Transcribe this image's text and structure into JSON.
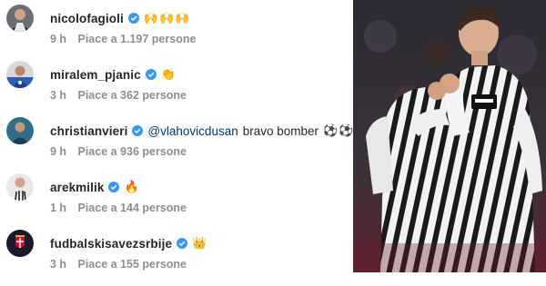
{
  "comments": [
    {
      "username": "nicolofagioli",
      "verified": true,
      "mention": "",
      "text": "",
      "emoji": "🙌🙌🙌",
      "time": "9 h",
      "likes": "Piace a 1.197 persone",
      "avatar": "avatar-fagioli"
    },
    {
      "username": "miralem_pjanic",
      "verified": true,
      "mention": "",
      "text": "",
      "emoji": "👏",
      "time": "3 h",
      "likes": "Piace a 362 persone",
      "avatar": "avatar-pjanic"
    },
    {
      "username": "christianvieri",
      "verified": true,
      "mention": "@vlahovicdusan",
      "text": "bravo bomber",
      "emoji": "⚽⚽",
      "time": "9 h",
      "likes": "Piace a 936 persone",
      "avatar": "avatar-vieri"
    },
    {
      "username": "arekmilik",
      "verified": true,
      "mention": "",
      "text": "",
      "emoji": "🔥",
      "time": "1 h",
      "likes": "Piace a 144 persone",
      "avatar": "avatar-milik"
    },
    {
      "username": "fudbalskisavezsrbije",
      "verified": true,
      "mention": "",
      "text": "",
      "emoji": "👑",
      "time": "3 h",
      "likes": "Piace a 155 persone",
      "avatar": "avatar-fss"
    }
  ],
  "colors": {
    "verified": "#3897f0",
    "text": "#262626",
    "meta": "#8e8e8e",
    "mention": "#00376b"
  }
}
